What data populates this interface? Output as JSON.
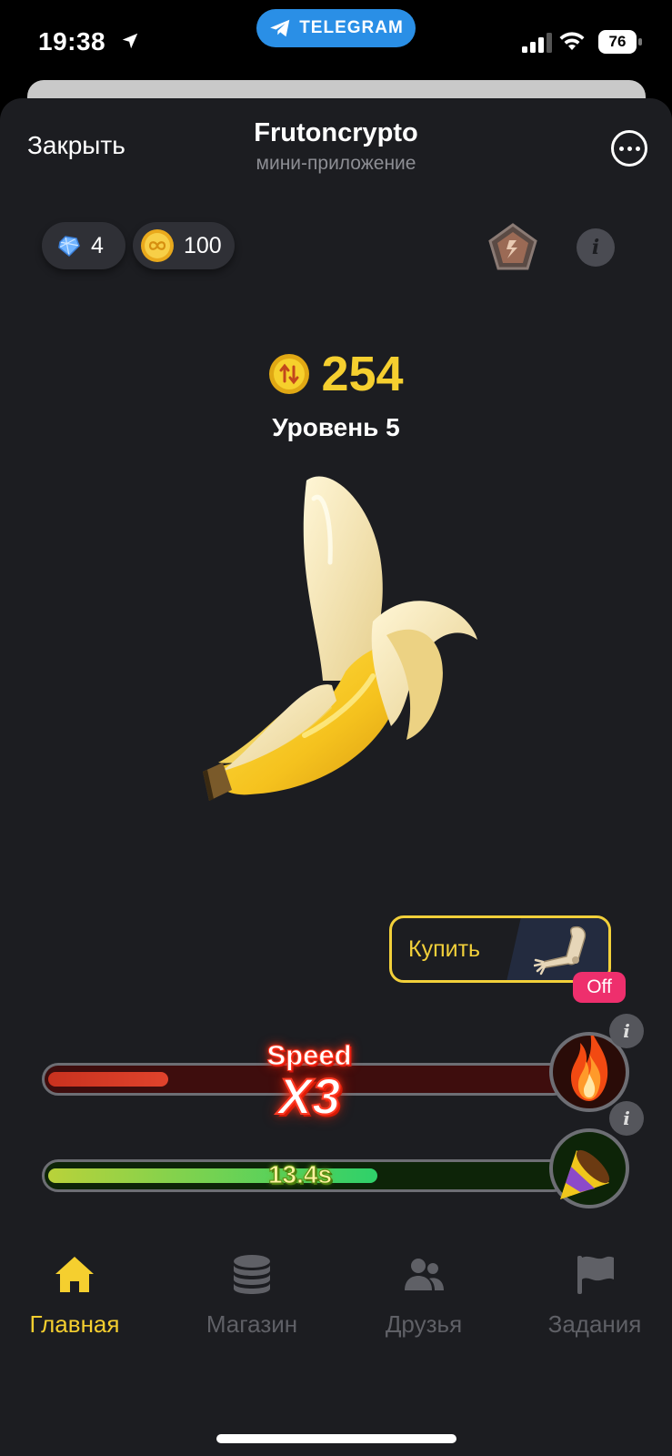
{
  "status_bar": {
    "time": "19:38",
    "telegram_label": "TELEGRAM",
    "battery": "76"
  },
  "header": {
    "close_label": "Закрыть",
    "title": "Frutoncrypto",
    "subtitle": "мини-приложение"
  },
  "currencies": {
    "gems": "4",
    "coins": "100"
  },
  "score": {
    "value": "254",
    "level": "Уровень 5"
  },
  "buy": {
    "label": "Купить",
    "status_badge": "Off"
  },
  "boosts": {
    "speed_label": "Speed",
    "speed_multiplier": "X3",
    "speed_progress": 0.23,
    "timer_label": "13.4s",
    "timer_progress": 0.63
  },
  "nav": {
    "items": [
      {
        "label": "Главная",
        "icon": "home-icon",
        "active": true
      },
      {
        "label": "Магазин",
        "icon": "coins-stack-icon",
        "active": false
      },
      {
        "label": "Друзья",
        "icon": "users-icon",
        "active": false
      },
      {
        "label": "Задания",
        "icon": "flag-icon",
        "active": false
      }
    ]
  },
  "colors": {
    "accent": "#f5cf2f",
    "background": "#1c1d21",
    "telegram": "#2a8fe6",
    "off_badge": "#ee2f6d"
  }
}
